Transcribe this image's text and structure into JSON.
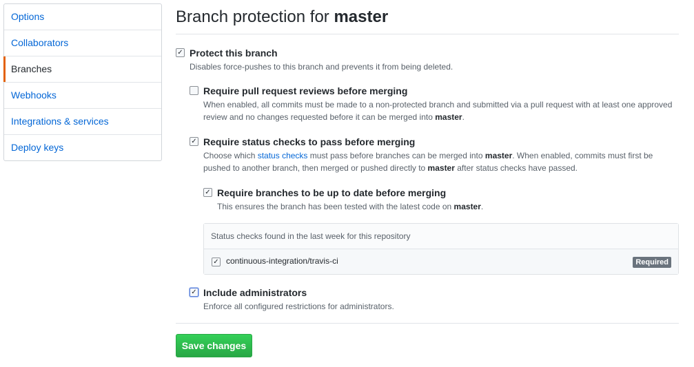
{
  "sidebar": {
    "items": [
      {
        "label": "Options"
      },
      {
        "label": "Collaborators"
      },
      {
        "label": "Branches"
      },
      {
        "label": "Webhooks"
      },
      {
        "label": "Integrations & services"
      },
      {
        "label": "Deploy keys"
      }
    ],
    "selected": "Branches"
  },
  "page": {
    "title_prefix": "Branch protection for ",
    "branch": "master"
  },
  "options": {
    "protect": {
      "checked": true,
      "label": "Protect this branch",
      "desc": "Disables force-pushes to this branch and prevents it from being deleted."
    },
    "reviews": {
      "checked": false,
      "label": "Require pull request reviews before merging",
      "desc_1": "When enabled, all commits must be made to a non-protected branch and submitted via a pull request with at least one approved review and no changes requested before it can be merged into ",
      "branch": "master",
      "desc_end": "."
    },
    "status_checks": {
      "checked": true,
      "label": "Require status checks to pass before merging",
      "desc_pre": "Choose which ",
      "desc_link": "status checks",
      "desc_mid": " must pass before branches can be merged into ",
      "branch": "master",
      "desc_mid2": ". When enabled, commits must first be pushed to another branch, then merged or pushed directly to ",
      "desc_end": " after status checks have passed."
    },
    "up_to_date": {
      "checked": true,
      "label": "Require branches to be up to date before merging",
      "desc_pre": "This ensures the branch has been tested with the latest code on ",
      "branch": "master",
      "desc_end": "."
    },
    "admins": {
      "checked": true,
      "label": "Include administrators",
      "desc": "Enforce all configured restrictions for administrators."
    }
  },
  "checks_box": {
    "header": "Status checks found in the last week for this repository",
    "items": [
      {
        "name": "continuous-integration/travis-ci",
        "checked": true,
        "badge": "Required"
      }
    ]
  },
  "save_label": "Save changes"
}
